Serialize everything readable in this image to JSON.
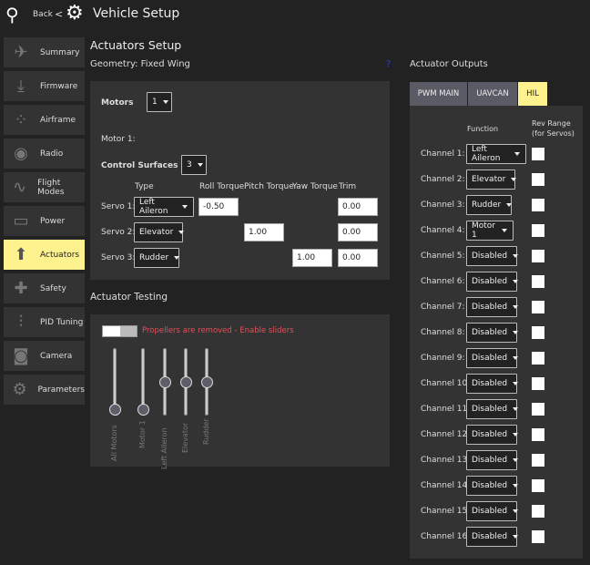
{
  "header": {
    "back": "Back",
    "separator": "<",
    "title": "Vehicle Setup"
  },
  "sidebar": [
    {
      "label": "Summary",
      "icon": "plane-icon",
      "glyph": "✈"
    },
    {
      "label": "Firmware",
      "icon": "download-icon",
      "glyph": "⤓"
    },
    {
      "label": "Airframe",
      "icon": "airframe-icon",
      "glyph": "⁘"
    },
    {
      "label": "Radio",
      "icon": "radio-icon",
      "glyph": "◉"
    },
    {
      "label": "Flight Modes",
      "icon": "wave-icon",
      "glyph": "∿"
    },
    {
      "label": "Power",
      "icon": "battery-icon",
      "glyph": "▭"
    },
    {
      "label": "Actuators",
      "icon": "actuator-icon",
      "glyph": "⬆",
      "active": true
    },
    {
      "label": "Safety",
      "icon": "medkit-icon",
      "glyph": "✚"
    },
    {
      "label": "PID Tuning",
      "icon": "sliders-icon",
      "glyph": "⫶"
    },
    {
      "label": "Camera",
      "icon": "camera-icon",
      "glyph": "◙"
    },
    {
      "label": "Parameters",
      "icon": "gears-icon",
      "glyph": "⚙"
    }
  ],
  "setup": {
    "title": "Actuators Setup",
    "geometry": "Geometry: Fixed Wing",
    "help": "?",
    "motors_label": "Motors",
    "motors_value": "1",
    "motor1_label": "Motor 1:",
    "cs_label": "Control Surfaces",
    "cs_value": "3",
    "headers": {
      "type": "Type",
      "roll": "Roll Torque",
      "pitch": "Pitch Torque",
      "yaw": "Yaw Torque",
      "trim": "Trim"
    },
    "servos": [
      {
        "label": "Servo 1:",
        "type": "Left Aileron",
        "roll": "-0.50",
        "pitch": null,
        "yaw": null,
        "trim": "0.00"
      },
      {
        "label": "Servo 2:",
        "type": "Elevator",
        "roll": null,
        "pitch": "1.00",
        "yaw": null,
        "trim": "0.00"
      },
      {
        "label": "Servo 3:",
        "type": "Rudder",
        "roll": null,
        "pitch": null,
        "yaw": "1.00",
        "trim": "0.00"
      }
    ]
  },
  "testing": {
    "title": "Actuator Testing",
    "warning": "Propellers are removed - Enable sliders",
    "warning_color": "#e0505a",
    "sliders": [
      {
        "label": "All Motors",
        "value": 0
      },
      {
        "label": "Motor 1",
        "value": 0
      },
      {
        "label": "Left Aileron",
        "value": 0.5
      },
      {
        "label": "Elevator",
        "value": 0.5
      },
      {
        "label": "Rudder",
        "value": 0.5
      }
    ]
  },
  "outputs": {
    "title": "Actuator Outputs",
    "tabs": [
      "PWM MAIN",
      "UAVCAN",
      "HIL"
    ],
    "active_tab": 2,
    "function_header": "Function",
    "rev_header": "Rev Range\n(for Servos)",
    "rev_header_1": "Rev Range",
    "rev_header_2": "(for Servos)",
    "channels": [
      {
        "label": "Channel 1:",
        "function": "Left Aileron"
      },
      {
        "label": "Channel 2:",
        "function": "Elevator"
      },
      {
        "label": "Channel 3:",
        "function": "Rudder"
      },
      {
        "label": "Channel 4:",
        "function": "Motor 1"
      },
      {
        "label": "Channel 5:",
        "function": "Disabled"
      },
      {
        "label": "Channel 6:",
        "function": "Disabled"
      },
      {
        "label": "Channel 7:",
        "function": "Disabled"
      },
      {
        "label": "Channel 8:",
        "function": "Disabled"
      },
      {
        "label": "Channel 9:",
        "function": "Disabled"
      },
      {
        "label": "Channel 10:",
        "function": "Disabled"
      },
      {
        "label": "Channel 11:",
        "function": "Disabled"
      },
      {
        "label": "Channel 12:",
        "function": "Disabled"
      },
      {
        "label": "Channel 13:",
        "function": "Disabled"
      },
      {
        "label": "Channel 14:",
        "function": "Disabled"
      },
      {
        "label": "Channel 15:",
        "function": "Disabled"
      },
      {
        "label": "Channel 16:",
        "function": "Disabled"
      }
    ]
  },
  "colors": {
    "accent": "#fef28f",
    "panel": "#333333",
    "background": "#222222"
  }
}
